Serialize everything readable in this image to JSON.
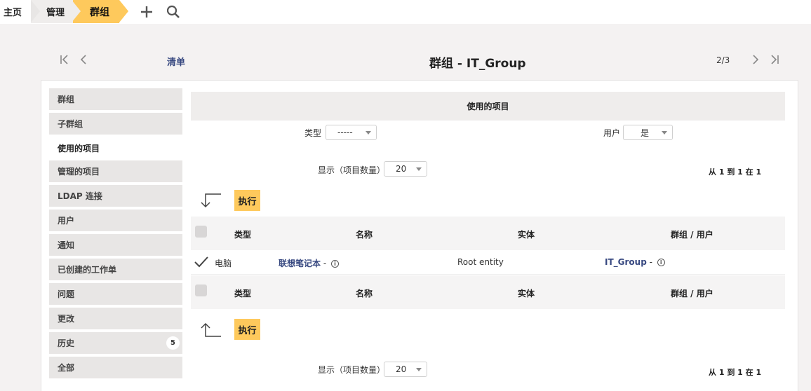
{
  "breadcrumb": {
    "home": "主页",
    "admin": "管理",
    "current": "群组"
  },
  "nav": {
    "list_label": "清单",
    "title": "群组 - IT_Group",
    "pager": "2/3"
  },
  "sidebar": {
    "items": [
      {
        "label": "群组"
      },
      {
        "label": "子群组"
      },
      {
        "label": "使用的项目"
      },
      {
        "label": "管理的项目"
      },
      {
        "label": "LDAP 连接"
      },
      {
        "label": "用户"
      },
      {
        "label": "通知"
      },
      {
        "label": "已创建的工作单"
      },
      {
        "label": "问题"
      },
      {
        "label": "更改"
      },
      {
        "label": "历史",
        "badge": "5"
      },
      {
        "label": "全部"
      }
    ],
    "active_index": 2
  },
  "section": {
    "title": "使用的项目",
    "filter_type_label": "类型",
    "filter_type_value": "-----",
    "filter_user_label": "用户",
    "filter_user_value": "是",
    "display_label": "显示（项目数量）",
    "display_value": "20",
    "count_text": "从 1 到 1 在 1",
    "execute_label": "执行"
  },
  "table": {
    "headers": {
      "type": "类型",
      "name": "名称",
      "entity": "实体",
      "group_user": "群组 / 用户"
    },
    "rows": [
      {
        "type": "电脑",
        "name": "联想笔记本",
        "entity": "Root entity",
        "group_user": "IT_Group"
      }
    ],
    "name_suffix": "-",
    "group_suffix": "-"
  },
  "colors": {
    "accent": "#fec95c",
    "link": "#374880",
    "sidebar_bg": "#e8e6e5"
  }
}
